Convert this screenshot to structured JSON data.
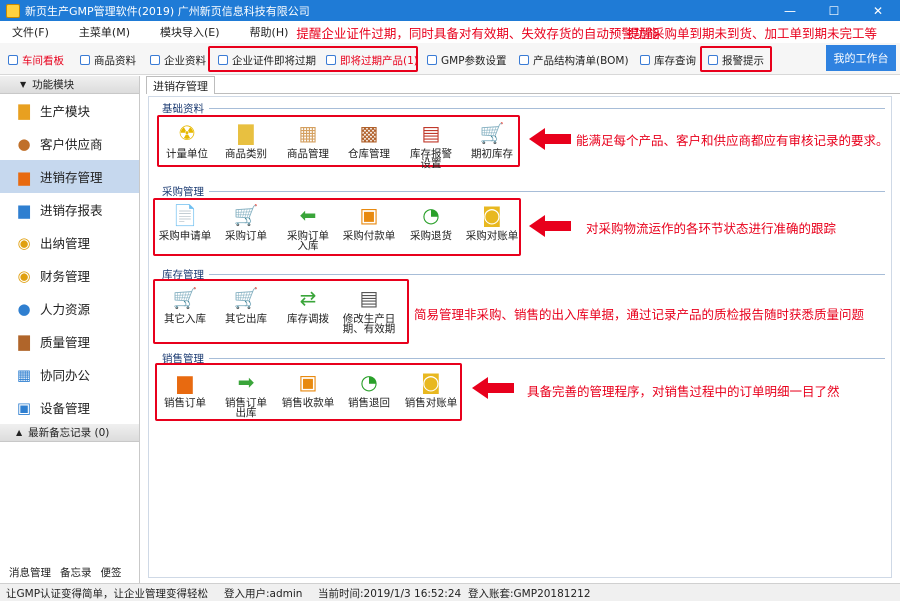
{
  "window": {
    "title": "新页生产GMP管理软件(2019) 广州新页信息科技有限公司",
    "minimize": "—",
    "maximize": "☐",
    "close": "✕"
  },
  "menu": {
    "items": [
      "文件(F)",
      "主菜单(M)",
      "模块导入(E)",
      "帮助(H)"
    ],
    "note_left": "提醒企业证件过期，同时具备对有效期、失效存货的自动预警功能",
    "note_right": "提醒采购单到期未到货、加工单到期未完工等"
  },
  "toolbar": {
    "items": [
      "车间看板",
      "商品资料",
      "企业资料",
      "企业证件即将过期",
      "即将过期产品(1)",
      "GMP参数设置",
      "产品结构清单(BOM)",
      "库存查询",
      "报警提示"
    ],
    "workbench": "我的工作台"
  },
  "sidebar": {
    "header": "功能模块",
    "items": [
      "生产模块",
      "客户供应商",
      "进销存管理",
      "进销存报表",
      "出纳管理",
      "财务管理",
      "人力资源",
      "质量管理",
      "协同办公",
      "设备管理"
    ],
    "memo": "最新备忘记录 (0)",
    "bottom": [
      "消息管理",
      "备忘录",
      "便签"
    ]
  },
  "tab": {
    "label": "进销存管理"
  },
  "sections": {
    "basic": {
      "title": "基础资料",
      "buttons": [
        "计量单位",
        "商品类别",
        "商品管理",
        "仓库管理",
        "库存报警设置",
        "期初库存"
      ],
      "note": "能满足每个产品、客户和供应商都应有审核记录的要求。"
    },
    "purchase": {
      "title": "采购管理",
      "buttons": [
        "采购申请单",
        "采购订单",
        "采购订单入库",
        "采购付款单",
        "采购退货",
        "采购对账单"
      ],
      "note": "对采购物流运作的各环节状态进行准确的跟踪"
    },
    "stock": {
      "title": "库存管理",
      "buttons": [
        "其它入库",
        "其它出库",
        "库存调拨",
        "修改生产日期、有效期"
      ],
      "note": "简易管理非采购、销售的出入库单据，通过记录产品的质检报告随时获悉质量问题"
    },
    "sales": {
      "title": "销售管理",
      "buttons": [
        "销售订单",
        "销售订单出库",
        "销售收款单",
        "销售退回",
        "销售对账单"
      ],
      "note": "具备完善的管理程序，对销售过程中的订单明细一目了然"
    }
  },
  "status": {
    "slogan": "让GMP认证变得简单，让企业管理变得轻松",
    "user": "登入用户:admin",
    "time": "当前时间:2019/1/3 16:52:24",
    "account": "登入账套:GMP20181212"
  },
  "icons": {
    "measure": "radiation-icon",
    "category": "folder-icon",
    "goods": "box-icon",
    "warehouse": "crates-icon",
    "alarm": "calendar-icon",
    "opening": "cart-plus-icon",
    "requisition": "document-icon",
    "order": "cart-icon",
    "inbound": "arrow-left-icon",
    "payment": "rss-icon",
    "return": "refresh-icon",
    "reconcile": "coins-icon"
  },
  "colors": {
    "accent": "#1f7bd6",
    "annotation": "#e8001c",
    "workbench": "#2f82e0"
  }
}
